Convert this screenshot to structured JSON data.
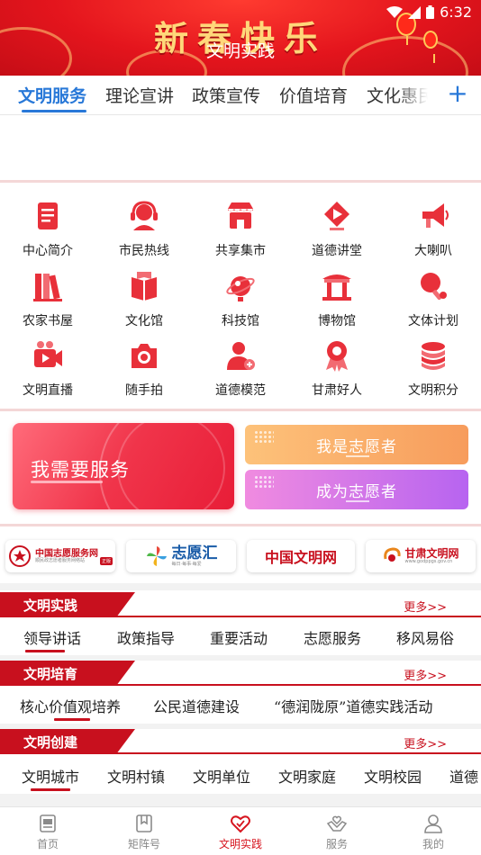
{
  "header": {
    "banner_text": "新春快乐",
    "title": "文明实践",
    "time": "6:32"
  },
  "tabs": {
    "items": [
      "文明服务",
      "理论宣讲",
      "政策宣传",
      "价值培育",
      "文化惠民"
    ],
    "active": 0,
    "add_icon": "plus-icon"
  },
  "grid": {
    "items": [
      {
        "label": "中心简介",
        "icon": "document-icon"
      },
      {
        "label": "市民热线",
        "icon": "headset-icon"
      },
      {
        "label": "共享集市",
        "icon": "shop-icon"
      },
      {
        "label": "道德讲堂",
        "icon": "play-diamond-icon"
      },
      {
        "label": "大喇叭",
        "icon": "megaphone-icon"
      },
      {
        "label": "农家书屋",
        "icon": "books-icon"
      },
      {
        "label": "文化馆",
        "icon": "open-book-icon"
      },
      {
        "label": "科技馆",
        "icon": "satellite-icon"
      },
      {
        "label": "博物馆",
        "icon": "museum-icon"
      },
      {
        "label": "文体计划",
        "icon": "table-tennis-icon"
      },
      {
        "label": "文明直播",
        "icon": "video-camera-icon"
      },
      {
        "label": "随手拍",
        "icon": "camera-icon"
      },
      {
        "label": "道德模范",
        "icon": "person-add-icon"
      },
      {
        "label": "甘肃好人",
        "icon": "award-ribbon-icon"
      },
      {
        "label": "文明积分",
        "icon": "coins-icon"
      }
    ],
    "accent": "#e8303a"
  },
  "volunteer": {
    "need_service": "我需要服务",
    "i_am_volunteer": "我是志愿者",
    "become_volunteer": "成为志愿者"
  },
  "partners": {
    "items": [
      "中国志愿服务网",
      "志愿汇",
      "中国文明网",
      "甘肃文明网"
    ],
    "p1_sub": "顺民政志愿者服务网络站",
    "p1_badge": "正版",
    "p2_sub": "每日·每事·每爱",
    "p4_sub": "www.godppgs.gov.cn"
  },
  "sections": [
    {
      "title": "文明实践",
      "more": "更多>>",
      "items": [
        "领导讲话",
        "政策指导",
        "重要活动",
        "志愿服务",
        "移风易俗"
      ]
    },
    {
      "title": "文明培育",
      "more": "更多>>",
      "items": [
        "核心价值观培养",
        "公民道德建设",
        "“德润陇原”道德实践活动"
      ]
    },
    {
      "title": "文明创建",
      "more": "更多>>",
      "items": [
        "文明城市",
        "文明村镇",
        "文明单位",
        "文明家庭",
        "文明校园",
        "道德"
      ]
    }
  ],
  "bottom_nav": {
    "items": [
      {
        "label": "首页",
        "icon": "home-doc-icon"
      },
      {
        "label": "矩阵号",
        "icon": "bookmark-icon"
      },
      {
        "label": "文明实践",
        "icon": "heart-icon"
      },
      {
        "label": "服务",
        "icon": "hands-heart-icon"
      },
      {
        "label": "我的",
        "icon": "user-icon"
      }
    ],
    "active": 2,
    "active_color": "#d7151f"
  }
}
